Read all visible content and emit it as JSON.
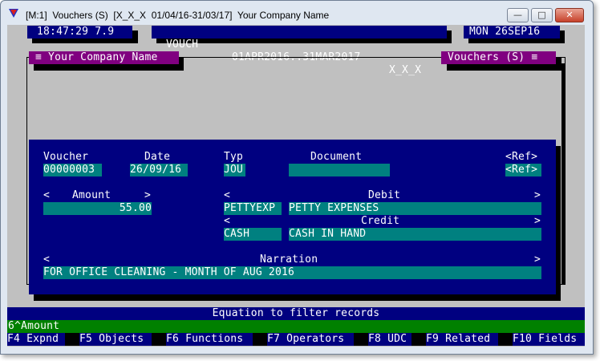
{
  "window": {
    "title": "[M:1]  Vouchers (S)  [X_X_X  01/04/16-31/03/17]  Your Company Name",
    "min_glyph": "—",
    "max_glyph": "□",
    "close_glyph": "✕"
  },
  "status": {
    "clock": "18:47:29 7.9",
    "module": "VOUCH",
    "period": "01APR2016..31MAR2017",
    "company_code": "X_X_X",
    "date": "MON 26SEP16"
  },
  "panel": {
    "left_title": "≡ Your Company Name",
    "right_title": "Vouchers (S) ≡"
  },
  "form": {
    "voucher_label": "Voucher",
    "voucher_value": "00000003",
    "date_label": "Date",
    "date_value": "26/09/16",
    "type_label": "Typ",
    "type_value": "JOU",
    "document_label": "Document",
    "document_value": "",
    "ref_label": "<Ref>",
    "ref_value": "<Ref>",
    "amount_left": "<",
    "amount_label": "Amount",
    "amount_right": ">",
    "amount_value": "55.00",
    "debit_left": "<",
    "debit_label": "Debit",
    "debit_right": ">",
    "debit_code": "PETTYEXP",
    "debit_name": "PETTY EXPENSES",
    "credit_left": "<",
    "credit_label": "Credit",
    "credit_right": ">",
    "credit_code": "CASH",
    "credit_name": "CASH IN HAND",
    "narr_left": "<",
    "narr_label": "Narration",
    "narr_right": ">",
    "narration_value": "FOR OFFICE CLEANING - MONTH OF AUG 2016"
  },
  "filter": {
    "prompt": "Equation to filter records",
    "value": "6^Amount"
  },
  "fkeys": [
    "F4 Expnd",
    "F5 Objects",
    "F6 Functions",
    "F7 Operators",
    "F8 UDC",
    "F9 Related",
    "F10 Fields"
  ]
}
